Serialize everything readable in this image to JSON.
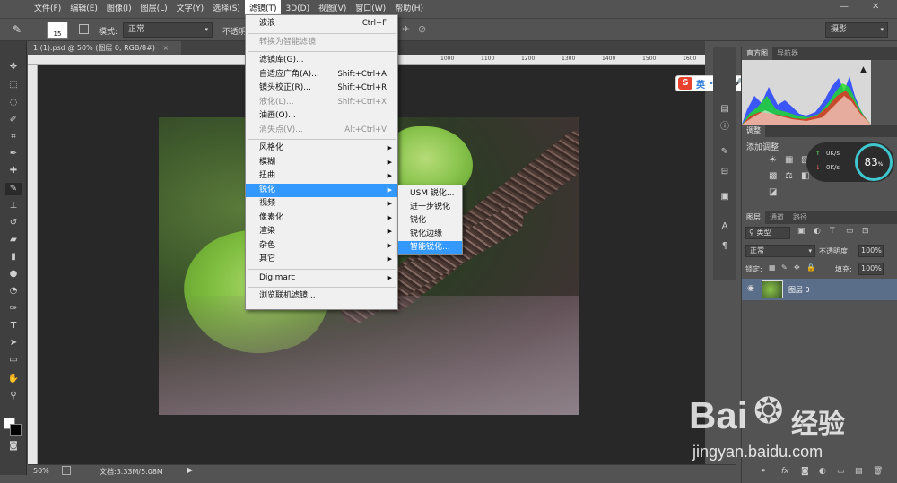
{
  "menubar": {
    "items": [
      "文件(F)",
      "编辑(E)",
      "图像(I)",
      "图层(L)",
      "文字(Y)",
      "选择(S)",
      "滤镜(T)",
      "3D(D)",
      "视图(V)",
      "窗口(W)",
      "帮助(H)"
    ],
    "active_index": 6
  },
  "options_bar": {
    "brush_size": "15",
    "mode_label": "模式:",
    "mode_value": "正常",
    "opacity_label": "不透明",
    "workspace": "摄影"
  },
  "document": {
    "tab_title": "1 (1).psd @ 50% (图层 0, RGB/8#)",
    "ruler_ticks": [
      "1000",
      "1100",
      "1200",
      "1300",
      "1400",
      "1500",
      "1600"
    ],
    "ruler_right": "1600",
    "zoom": "50%",
    "doc_info": "文档:3.33M/5.08M"
  },
  "filter_menu": {
    "items": [
      {
        "label": "波浪",
        "shortcut": "Ctrl+F",
        "disabled": false,
        "submenu": false
      },
      {
        "sep": true
      },
      {
        "label": "转换为智能滤镜",
        "shortcut": "",
        "disabled": true,
        "submenu": false
      },
      {
        "sep": true
      },
      {
        "label": "滤镜库(G)...",
        "shortcut": "",
        "disabled": false,
        "submenu": false
      },
      {
        "label": "自适应广角(A)...",
        "shortcut": "Shift+Ctrl+A",
        "disabled": false,
        "submenu": false
      },
      {
        "label": "镜头校正(R)...",
        "shortcut": "Shift+Ctrl+R",
        "disabled": false,
        "submenu": false
      },
      {
        "label": "液化(L)...",
        "shortcut": "Shift+Ctrl+X",
        "disabled": true,
        "submenu": false
      },
      {
        "label": "油画(O)...",
        "shortcut": "",
        "disabled": false,
        "submenu": false
      },
      {
        "label": "消失点(V)...",
        "shortcut": "Alt+Ctrl+V",
        "disabled": true,
        "submenu": false
      },
      {
        "sep": true
      },
      {
        "label": "风格化",
        "shortcut": "",
        "disabled": false,
        "submenu": true
      },
      {
        "label": "模糊",
        "shortcut": "",
        "disabled": false,
        "submenu": true
      },
      {
        "label": "扭曲",
        "shortcut": "",
        "disabled": false,
        "submenu": true
      },
      {
        "label": "锐化",
        "shortcut": "",
        "disabled": false,
        "submenu": true,
        "selected": true
      },
      {
        "label": "视频",
        "shortcut": "",
        "disabled": false,
        "submenu": true
      },
      {
        "label": "像素化",
        "shortcut": "",
        "disabled": false,
        "submenu": true
      },
      {
        "label": "渲染",
        "shortcut": "",
        "disabled": false,
        "submenu": true
      },
      {
        "label": "杂色",
        "shortcut": "",
        "disabled": false,
        "submenu": true
      },
      {
        "label": "其它",
        "shortcut": "",
        "disabled": false,
        "submenu": true
      },
      {
        "sep": true
      },
      {
        "label": "Digimarc",
        "shortcut": "",
        "disabled": false,
        "submenu": true
      },
      {
        "sep": true
      },
      {
        "label": "浏览联机滤镜...",
        "shortcut": "",
        "disabled": false,
        "submenu": false
      }
    ]
  },
  "sharpen_submenu": {
    "items": [
      "USM 锐化...",
      "进一步锐化",
      "锐化",
      "锐化边缘",
      "智能锐化..."
    ],
    "selected_index": 4
  },
  "panels": {
    "histogram_tabs": [
      "直方图",
      "导航器"
    ],
    "adjust_tab": "调整",
    "adjust_title": "添加调整",
    "net_up": "0K/s",
    "net_down": "0K/s",
    "cpu_percent": "83",
    "cpu_suffix": "%",
    "layers_tabs": [
      "图层",
      "通道",
      "路径"
    ],
    "kind_label": "类型",
    "blend_mode": "正常",
    "opacity_label": "不透明度:",
    "opacity_value": "100%",
    "lock_label": "锁定:",
    "fill_label": "填充:",
    "fill_value": "100%",
    "layer_name": "图层 0"
  },
  "ime": {
    "label": "英"
  },
  "watermark": {
    "brand": "Bai",
    "brand2": "经验",
    "url": "jingyan.baidu.com"
  }
}
